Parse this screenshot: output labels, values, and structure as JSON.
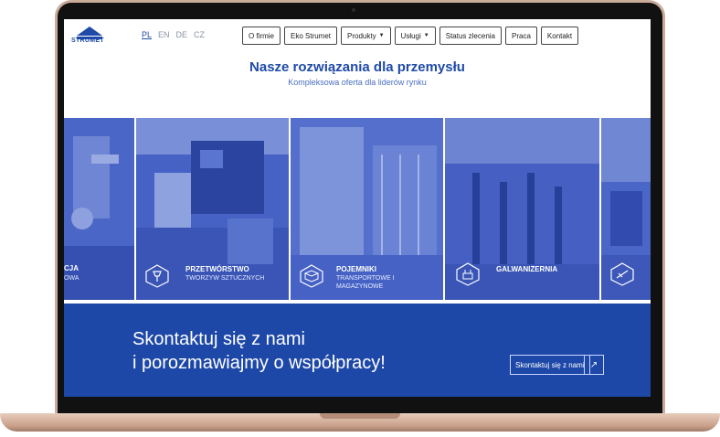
{
  "brand": {
    "logo_text": "STRUMET",
    "accent": "#1f4aa8"
  },
  "languages": [
    {
      "label": "PL",
      "active": true
    },
    {
      "label": "EN",
      "active": false
    },
    {
      "label": "DE",
      "active": false
    },
    {
      "label": "CZ",
      "active": false
    }
  ],
  "nav": [
    {
      "label": "O firmie",
      "dropdown": false
    },
    {
      "label": "Eko Strumet",
      "dropdown": false
    },
    {
      "label": "Produkty",
      "dropdown": true
    },
    {
      "label": "Usługi",
      "dropdown": true
    },
    {
      "label": "Status zlecenia",
      "dropdown": false
    },
    {
      "label": "Praca",
      "dropdown": false
    },
    {
      "label": "Kontakt",
      "dropdown": false
    }
  ],
  "hero": {
    "title": "Nasze rozwiązania dla przemysłu",
    "subtitle": "Kompleksowa oferta dla liderów rynku"
  },
  "tiles": [
    {
      "title": "CJA",
      "subtitle": "OWA",
      "icon": ""
    },
    {
      "title": "PRZETWÓRSTWO",
      "subtitle": "TWORZYW SZTUCZNYCH",
      "icon": "plastic-processing-icon"
    },
    {
      "title": "POJEMNIKI",
      "subtitle": "TRANSPORTOWE I MAGAZYNOWE",
      "icon": "container-icon"
    },
    {
      "title": "GALWANIZERNIA",
      "subtitle": "",
      "icon": "galvanizing-icon"
    },
    {
      "title": "",
      "subtitle": "",
      "icon": "welding-icon"
    }
  ],
  "contact": {
    "line1": "Skontaktuj się z nami",
    "line2": "i porozmawiajmy o współpracy!",
    "button_label": "Skontaktuj się z nami",
    "arrow": "↗"
  }
}
